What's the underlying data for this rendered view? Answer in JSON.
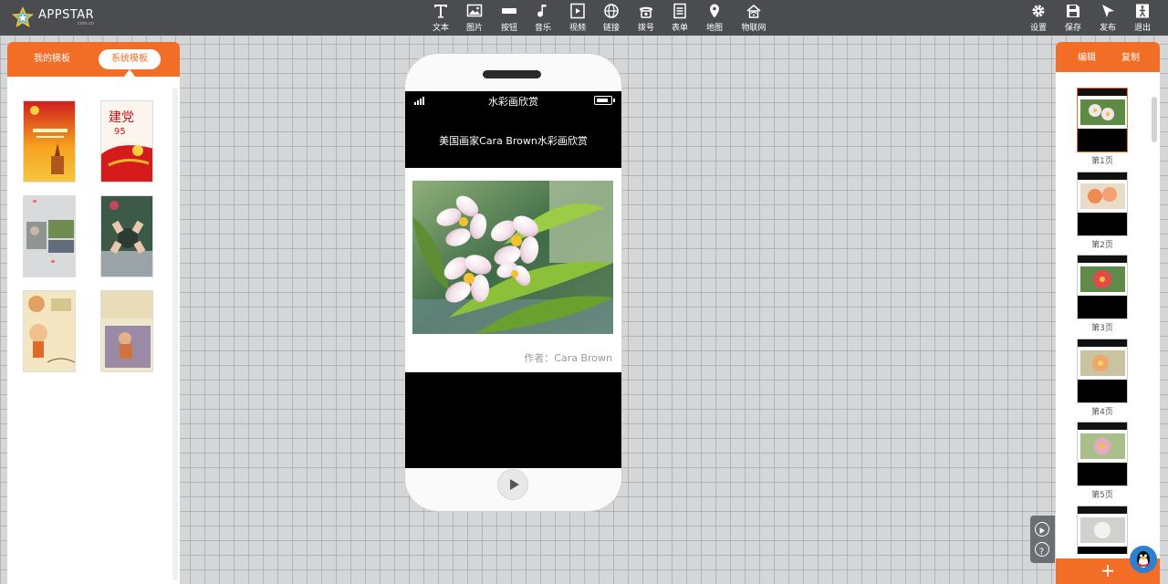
{
  "app": {
    "brand_name": "APPSTAR",
    "brand_sub": "com.cn"
  },
  "toolbar": {
    "tools": [
      {
        "label": "文本",
        "icon": "text-icon"
      },
      {
        "label": "图片",
        "icon": "image-icon"
      },
      {
        "label": "按钮",
        "icon": "button-icon"
      },
      {
        "label": "音乐",
        "icon": "music-icon"
      },
      {
        "label": "视频",
        "icon": "video-icon"
      },
      {
        "label": "链接",
        "icon": "globe-icon"
      },
      {
        "label": "拨号",
        "icon": "phone-icon"
      },
      {
        "label": "表单",
        "icon": "form-icon"
      },
      {
        "label": "地图",
        "icon": "map-pin-icon"
      },
      {
        "label": "物联网",
        "icon": "iot-icon"
      }
    ],
    "actions": [
      {
        "label": "设置",
        "icon": "gear-icon"
      },
      {
        "label": "保存",
        "icon": "save-icon"
      },
      {
        "label": "发布",
        "icon": "publish-icon"
      },
      {
        "label": "退出",
        "icon": "exit-icon"
      }
    ]
  },
  "left_panel": {
    "tab_mine": "我的模板",
    "tab_system": "系统模板",
    "active_tab": "系统模板",
    "thumb2_text": "建党",
    "thumb2_num": "95"
  },
  "phone": {
    "title": "水彩画欣赏",
    "headline": "美国画家Cara Brown水彩画欣赏",
    "author": "作者：Cara Brown"
  },
  "right_panel": {
    "tab_edit": "编辑",
    "tab_copy": "复制",
    "pages": [
      {
        "label": "第1页",
        "active": true
      },
      {
        "label": "第2页",
        "active": false
      },
      {
        "label": "第3页",
        "active": false
      },
      {
        "label": "第4页",
        "active": false
      },
      {
        "label": "第5页",
        "active": false
      }
    ],
    "add_label": "+"
  },
  "colors": {
    "accent": "#f26d25",
    "topbar": "#4a4c4f"
  }
}
